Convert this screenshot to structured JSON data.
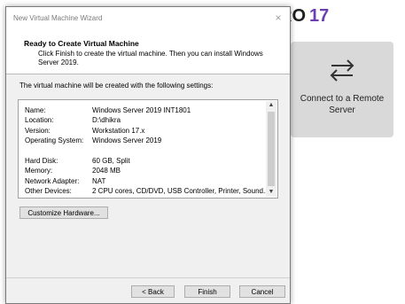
{
  "background_app": {
    "brand_text": "RO",
    "version": "17",
    "tile_label": "Connect to a Remote Server"
  },
  "dialog": {
    "title": "New Virtual Machine Wizard",
    "close_glyph": "×",
    "header_title": "Ready to Create Virtual Machine",
    "header_desc": "Click Finish to create the virtual machine. Then you can install Windows Server 2019.",
    "intro": "The virtual machine will be created with the following settings:",
    "settings": [
      {
        "key": "Name:",
        "value": "Windows Server 2019 INT1801"
      },
      {
        "key": "Location:",
        "value": "D:\\dhikra"
      },
      {
        "key": "Version:",
        "value": "Workstation 17.x"
      },
      {
        "key": "Operating System:",
        "value": "Windows Server 2019"
      },
      {
        "key": "Hard Disk:",
        "value": "60 GB, Split"
      },
      {
        "key": "Memory:",
        "value": "2048 MB"
      },
      {
        "key": "Network Adapter:",
        "value": "NAT"
      },
      {
        "key": "Other Devices:",
        "value": "2 CPU cores, CD/DVD, USB Controller, Printer, Sound..."
      }
    ],
    "buttons": {
      "customize": "Customize Hardware...",
      "back": "< Back",
      "finish": "Finish",
      "cancel": "Cancel"
    }
  }
}
